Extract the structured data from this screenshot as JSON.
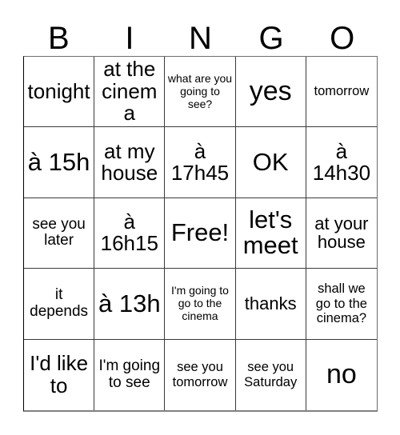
{
  "card": {
    "title_letters": [
      "B",
      "I",
      "N",
      "G",
      "O"
    ],
    "columns": 5,
    "rows": 5,
    "free_space_label": "Free!",
    "text_color": "#000000",
    "background_color": "#ffffff",
    "grid_line_color": "#3a3a3a",
    "cells": [
      {
        "text": "tonight",
        "size": "fs-xl",
        "row": 1,
        "col": 1
      },
      {
        "text": "at the cinema",
        "size": "fs-xl",
        "row": 1,
        "col": 2
      },
      {
        "text": "what are you going to see?",
        "size": "fs-xs",
        "row": 1,
        "col": 3
      },
      {
        "text": "yes",
        "size": "fs-huge",
        "row": 1,
        "col": 4
      },
      {
        "text": "tomorrow",
        "size": "fs-s",
        "row": 1,
        "col": 5
      },
      {
        "text": "à 15h",
        "size": "fs-xxl",
        "row": 2,
        "col": 1
      },
      {
        "text": "at my house",
        "size": "fs-xl",
        "row": 2,
        "col": 2
      },
      {
        "text": "à 17h45",
        "size": "fs-xl",
        "row": 2,
        "col": 3
      },
      {
        "text": "OK",
        "size": "fs-xxl",
        "row": 2,
        "col": 4
      },
      {
        "text": "à 14h30",
        "size": "fs-xl",
        "row": 2,
        "col": 5
      },
      {
        "text": "see you later",
        "size": "fs-m",
        "row": 3,
        "col": 1
      },
      {
        "text": "à 16h15",
        "size": "fs-xl",
        "row": 3,
        "col": 2
      },
      {
        "text": "Free!",
        "size": "fs-xxl",
        "row": 3,
        "col": 3
      },
      {
        "text": "let's meet",
        "size": "fs-xxl",
        "row": 3,
        "col": 4
      },
      {
        "text": "at your house",
        "size": "fs-l",
        "row": 3,
        "col": 5
      },
      {
        "text": "it depends",
        "size": "fs-m",
        "row": 4,
        "col": 1
      },
      {
        "text": "à 13h",
        "size": "fs-xxl",
        "row": 4,
        "col": 2
      },
      {
        "text": "I'm going to go to the cinema",
        "size": "fs-xs",
        "row": 4,
        "col": 3
      },
      {
        "text": "thanks",
        "size": "fs-l",
        "row": 4,
        "col": 4
      },
      {
        "text": "shall we go to the cinema?",
        "size": "fs-s",
        "row": 4,
        "col": 5
      },
      {
        "text": "I'd like to",
        "size": "fs-xl",
        "row": 5,
        "col": 1
      },
      {
        "text": "I'm going to see",
        "size": "fs-m",
        "row": 5,
        "col": 2
      },
      {
        "text": "see you tomorrow",
        "size": "fs-s",
        "row": 5,
        "col": 3
      },
      {
        "text": "see you Saturday",
        "size": "fs-s",
        "row": 5,
        "col": 4
      },
      {
        "text": "no",
        "size": "fs-huge",
        "row": 5,
        "col": 5
      }
    ]
  }
}
